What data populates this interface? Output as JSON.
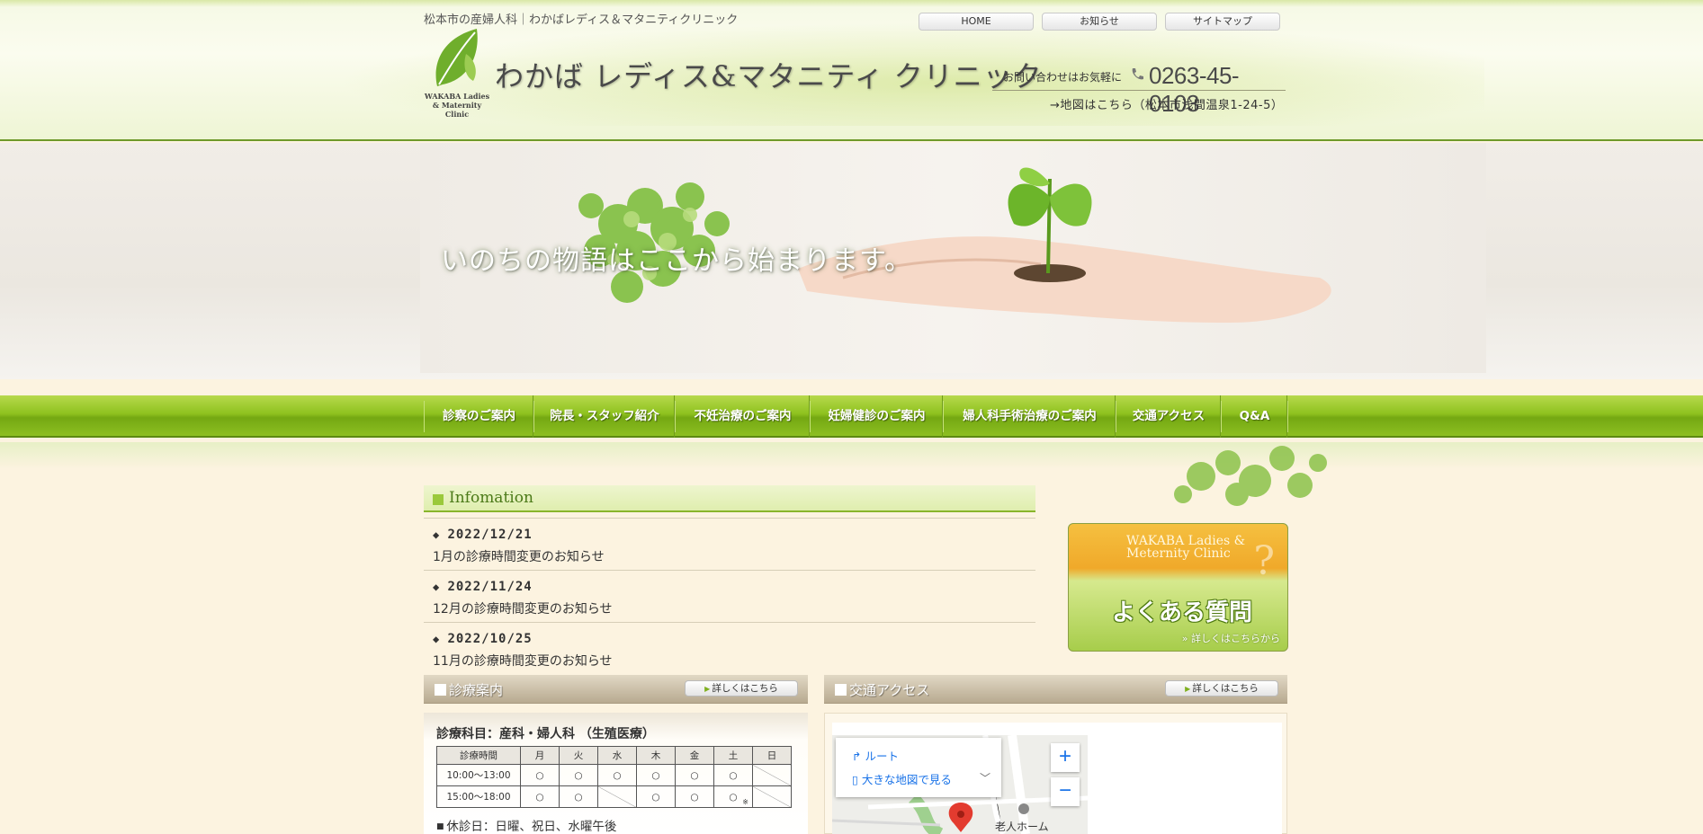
{
  "header": {
    "tagline": "松本市の産婦人科｜わかばレディス＆マタニティクリニック",
    "logo_en": "WAKABA Ladies & Maternity Clinic",
    "title": "わかば レディス&マタニティ クリニック",
    "top_links": [
      "HOME",
      "お知らせ",
      "サイトマップ"
    ],
    "contact_label": "お問い合わせはお気軽に",
    "phone": "0263-45-0103",
    "map_link": "→地図はこちら（松本市浅間温泉1-24-5）"
  },
  "hero": {
    "text": "いのちの物語はここから始まります。"
  },
  "nav": {
    "items": [
      "診察のご案内",
      "院長・スタッフ紹介",
      "不妊治療のご案内",
      "妊婦健診のご案内",
      "婦人科手術治療のご案内",
      "交通アクセス",
      "Q&A"
    ]
  },
  "info": {
    "title": "Infomation",
    "news": [
      {
        "date": "2022/12/21",
        "title": "1月の診療時間変更のお知らせ"
      },
      {
        "date": "2022/11/24",
        "title": "12月の診療時間変更のお知らせ"
      },
      {
        "date": "2022/10/25",
        "title": "11月の診療時間変更のお知らせ"
      }
    ]
  },
  "faq": {
    "en": "WAKABA Ladies & Meternity Clinic",
    "q_mark": "?",
    "title": "よくある質問",
    "more": "» 詳しくはこちらから"
  },
  "schedule": {
    "heading": "診療案内",
    "more": "詳しくはこちら",
    "subject": "診療科目：産科・婦人科 （生殖医療）",
    "header": [
      "診療時間",
      "月",
      "火",
      "水",
      "木",
      "金",
      "土",
      "日"
    ],
    "rows": [
      {
        "time": "10:00〜13:00",
        "cells": [
          "○",
          "○",
          "○",
          "○",
          "○",
          "○",
          ""
        ]
      },
      {
        "time": "15:00〜18:00",
        "cells": [
          "○",
          "○",
          "",
          "○",
          "○",
          "○",
          ""
        ]
      }
    ],
    "note_mark": "※",
    "holiday": "休診日：日曜、祝日、水曜午後"
  },
  "access": {
    "heading": "交通アクセス",
    "more": "詳しくはこちら",
    "route": "ルート",
    "big_map": "大きな地図で見る",
    "zoom_in": "+",
    "zoom_out": "−",
    "poi": "老人ホーム"
  },
  "colors": {
    "accent_green": "#8fc21f",
    "info_green": "#4b7a18",
    "map_blue": "#1a73e8"
  }
}
